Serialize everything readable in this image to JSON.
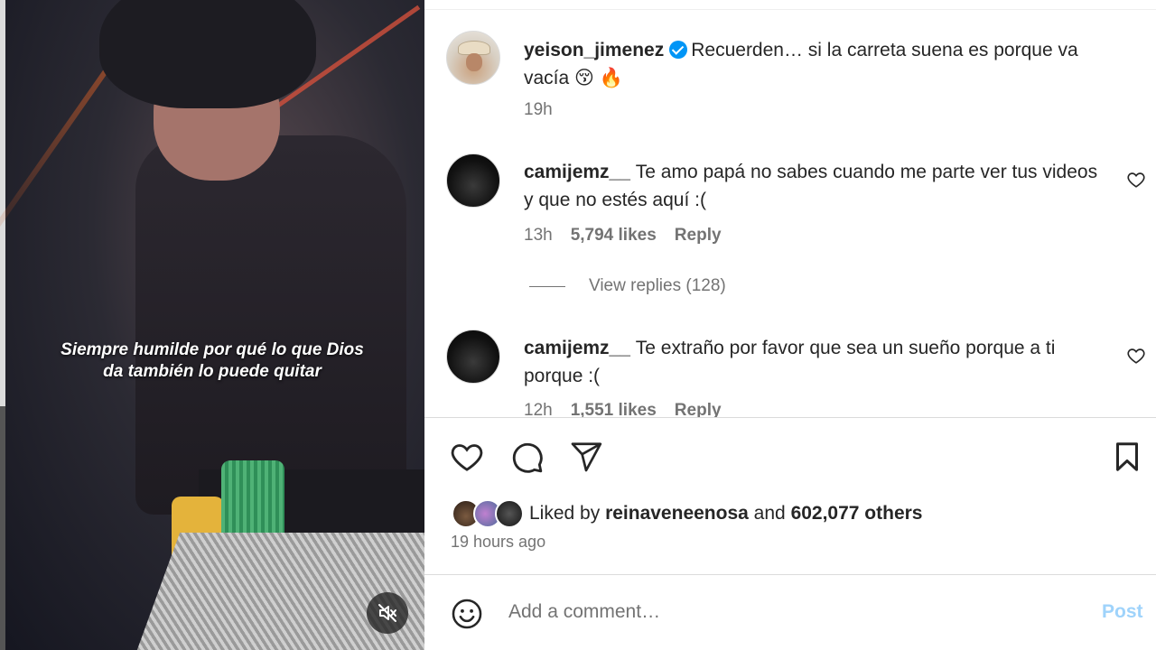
{
  "media": {
    "caption": "Siempre humilde por qué lo que Dios da también lo puede quitar",
    "mute_icon": "speaker-muted-icon"
  },
  "post": {
    "username": "yeison_jimenez",
    "verified": true,
    "caption": "Recuerden… si la carreta suena es porque va vacía 😚 🔥",
    "time": "19h"
  },
  "comments": [
    {
      "username": "camijemz__",
      "text": "Te amo papá no sabes cuando me parte ver tus videos y que no estés aquí :(",
      "time": "13h",
      "likes": "5,794 likes",
      "reply_label": "Reply",
      "view_replies": "View replies (128)"
    },
    {
      "username": "camijemz__",
      "text": "Te extraño por favor que sea un sueño porque a ti porque :(",
      "time": "12h",
      "likes": "1,551 likes",
      "reply_label": "Reply"
    }
  ],
  "actions": {
    "like_icon": "heart-icon",
    "comment_icon": "comment-bubble-icon",
    "share_icon": "paper-plane-icon",
    "save_icon": "bookmark-icon"
  },
  "likes": {
    "prefix": "Liked by",
    "user": "reinaveneenosa",
    "and": "and",
    "others": "602,077 others"
  },
  "post_time_ago": "19 hours ago",
  "comment_box": {
    "emoji_icon": "smiley-icon",
    "placeholder": "Add a comment…",
    "post_label": "Post"
  },
  "colors": {
    "verified_blue": "#0095f6",
    "post_button_disabled": "#9fd3fb",
    "secondary_text": "#737373"
  }
}
